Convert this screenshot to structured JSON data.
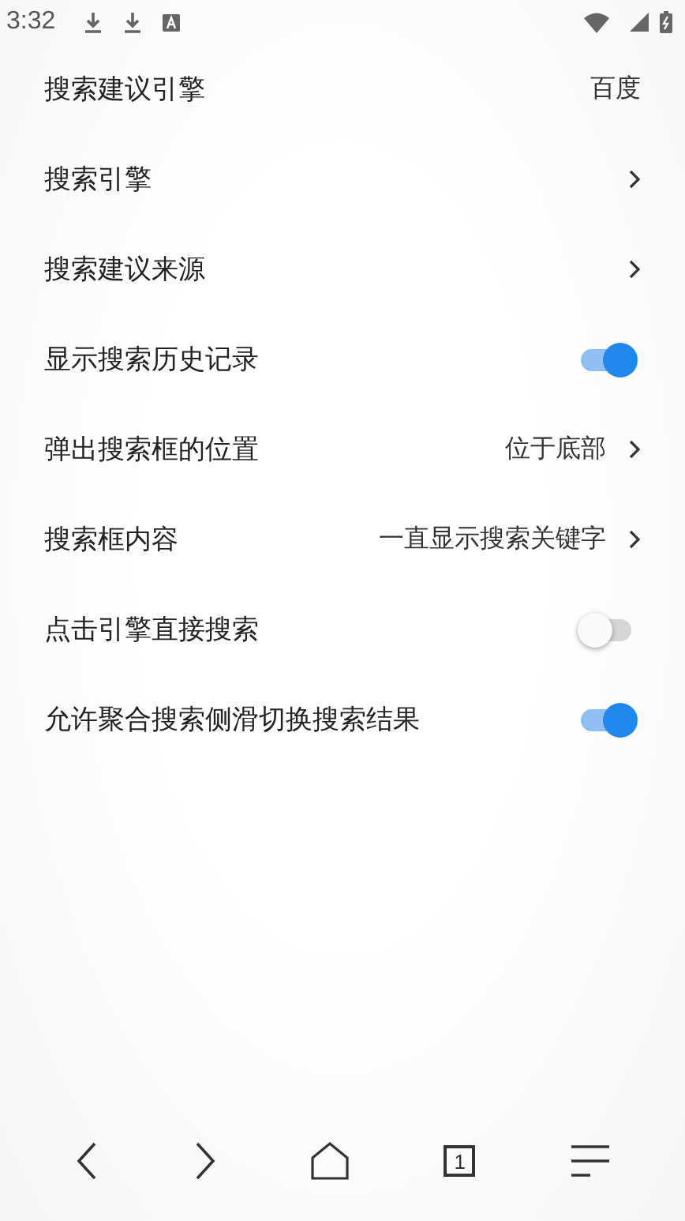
{
  "status_bar": {
    "time": "3:32"
  },
  "settings": [
    {
      "kind": "value",
      "label": "搜索建议引擎",
      "value": "百度"
    },
    {
      "kind": "nav",
      "label": "搜索引擎"
    },
    {
      "kind": "nav",
      "label": "搜索建议来源"
    },
    {
      "kind": "toggle",
      "label": "显示搜索历史记录",
      "on": true
    },
    {
      "kind": "nav",
      "label": "弹出搜索框的位置",
      "value": "位于底部"
    },
    {
      "kind": "nav",
      "label": "搜索框内容",
      "value": "一直显示搜索关键字"
    },
    {
      "kind": "toggle",
      "label": "点击引擎直接搜索",
      "on": false
    },
    {
      "kind": "toggle",
      "label": "允许聚合搜索侧滑切换搜索结果",
      "on": true
    }
  ],
  "bottom_nav": {
    "tab_count": "1"
  }
}
